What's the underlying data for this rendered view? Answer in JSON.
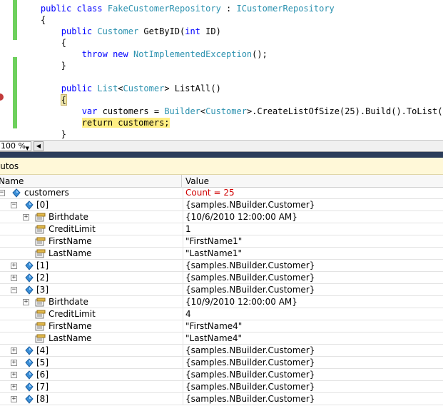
{
  "editor": {
    "lines": [
      [
        "public class FakeCustomerRepository : ICustomerRepository"
      ],
      [
        "{"
      ],
      [
        "public Customer GetByID(int ID)"
      ],
      [
        "{"
      ],
      [
        "throw new NotImplementedException();"
      ],
      [
        "}"
      ],
      [
        ""
      ],
      [
        "public List<Customer> ListAll()"
      ],
      [
        "{"
      ],
      [
        "var customers = Builder<Customer>.CreateListOfSize(25).Build().ToList();"
      ],
      [
        "return customers;"
      ],
      [
        "}"
      ]
    ],
    "tokens": {
      "l0": {
        "a": "public",
        "b": "class",
        "c": "FakeCustomerRepository",
        "d": " : ",
        "e": "ICustomerRepository"
      },
      "l2": {
        "a": "public",
        "b": "Customer",
        "c": "GetByID(",
        "d": "int",
        "e": " ID)"
      },
      "l4": {
        "a": "throw",
        "b": "new",
        "c": "NotImplementedException",
        "d": "();"
      },
      "l7": {
        "a": "public",
        "b": "List",
        "c": "<",
        "d": "Customer",
        "e": "> ListAll()"
      },
      "l9": {
        "a": "var",
        "b": "customers = ",
        "c": "Builder",
        "d": "<",
        "e": "Customer",
        "f": ">.CreateListOfSize(25).Build().ToList();"
      },
      "l10": {
        "a": "return customers;"
      },
      "brace": "{",
      "brace_close": "}"
    }
  },
  "zoom": {
    "value": "100 %"
  },
  "autos": {
    "title": "Autos",
    "col_name": "Name",
    "col_value": "Value",
    "rows": [
      {
        "name": "customers",
        "value": "Count = 25",
        "depth": 0,
        "expander": "minus",
        "icon": "field-icon",
        "red": true
      },
      {
        "name": "[0]",
        "value": "{samples.NBuilder.Customer}",
        "depth": 1,
        "expander": "minus",
        "icon": "field-icon"
      },
      {
        "name": "Birthdate",
        "value": "{10/6/2010 12:00:00 AM}",
        "depth": 2,
        "expander": "plus",
        "icon": "property-icon"
      },
      {
        "name": "CreditLimit",
        "value": "1",
        "depth": 2,
        "expander": "",
        "icon": "property-icon"
      },
      {
        "name": "FirstName",
        "value": "\"FirstName1\"",
        "depth": 2,
        "expander": "",
        "icon": "property-icon"
      },
      {
        "name": "LastName",
        "value": "\"LastName1\"",
        "depth": 2,
        "expander": "",
        "icon": "property-icon"
      },
      {
        "name": "[1]",
        "value": "{samples.NBuilder.Customer}",
        "depth": 1,
        "expander": "plus",
        "icon": "field-icon"
      },
      {
        "name": "[2]",
        "value": "{samples.NBuilder.Customer}",
        "depth": 1,
        "expander": "plus",
        "icon": "field-icon"
      },
      {
        "name": "[3]",
        "value": "{samples.NBuilder.Customer}",
        "depth": 1,
        "expander": "minus",
        "icon": "field-icon"
      },
      {
        "name": "Birthdate",
        "value": "{10/9/2010 12:00:00 AM}",
        "depth": 2,
        "expander": "plus",
        "icon": "property-icon"
      },
      {
        "name": "CreditLimit",
        "value": "4",
        "depth": 2,
        "expander": "",
        "icon": "property-icon"
      },
      {
        "name": "FirstName",
        "value": "\"FirstName4\"",
        "depth": 2,
        "expander": "",
        "icon": "property-icon"
      },
      {
        "name": "LastName",
        "value": "\"LastName4\"",
        "depth": 2,
        "expander": "",
        "icon": "property-icon"
      },
      {
        "name": "[4]",
        "value": "{samples.NBuilder.Customer}",
        "depth": 1,
        "expander": "plus",
        "icon": "field-icon"
      },
      {
        "name": "[5]",
        "value": "{samples.NBuilder.Customer}",
        "depth": 1,
        "expander": "plus",
        "icon": "field-icon"
      },
      {
        "name": "[6]",
        "value": "{samples.NBuilder.Customer}",
        "depth": 1,
        "expander": "plus",
        "icon": "field-icon"
      },
      {
        "name": "[7]",
        "value": "{samples.NBuilder.Customer}",
        "depth": 1,
        "expander": "plus",
        "icon": "field-icon"
      },
      {
        "name": "[8]",
        "value": "{samples.NBuilder.Customer}",
        "depth": 1,
        "expander": "plus",
        "icon": "field-icon"
      }
    ]
  },
  "colors": {
    "keyword": "#0000ff",
    "type": "#2b91af",
    "current_line": "#ffef84",
    "count_value": "#d00000",
    "change_bar": "#6ed05d"
  }
}
